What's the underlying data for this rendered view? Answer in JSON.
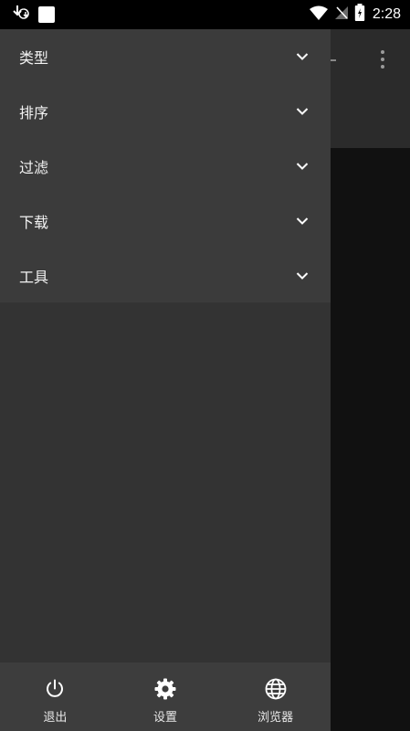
{
  "status_bar": {
    "time": "2:28",
    "icons": [
      "download-notification-icon",
      "app-notification-icon",
      "wifi-icon",
      "no-signal-icon",
      "battery-charging-icon"
    ]
  },
  "drawer": {
    "menu_items": [
      {
        "label": "类型",
        "icon": "chevron-down-icon"
      },
      {
        "label": "排序",
        "icon": "chevron-down-icon"
      },
      {
        "label": "过滤",
        "icon": "chevron-down-icon"
      },
      {
        "label": "下载",
        "icon": "chevron-down-icon"
      },
      {
        "label": "工具",
        "icon": "chevron-down-icon"
      }
    ],
    "bottom_actions": [
      {
        "label": "退出",
        "icon": "power-icon"
      },
      {
        "label": "设置",
        "icon": "gear-icon"
      },
      {
        "label": "浏览器",
        "icon": "globe-icon"
      }
    ]
  },
  "colors": {
    "status_bar": "#000000",
    "drawer_menu": "#3b3b3b",
    "drawer_body": "#333333",
    "drawer_bottom": "#3d3d3d",
    "app_toolbar": "#2b2b2b",
    "app_background": "#111111"
  }
}
